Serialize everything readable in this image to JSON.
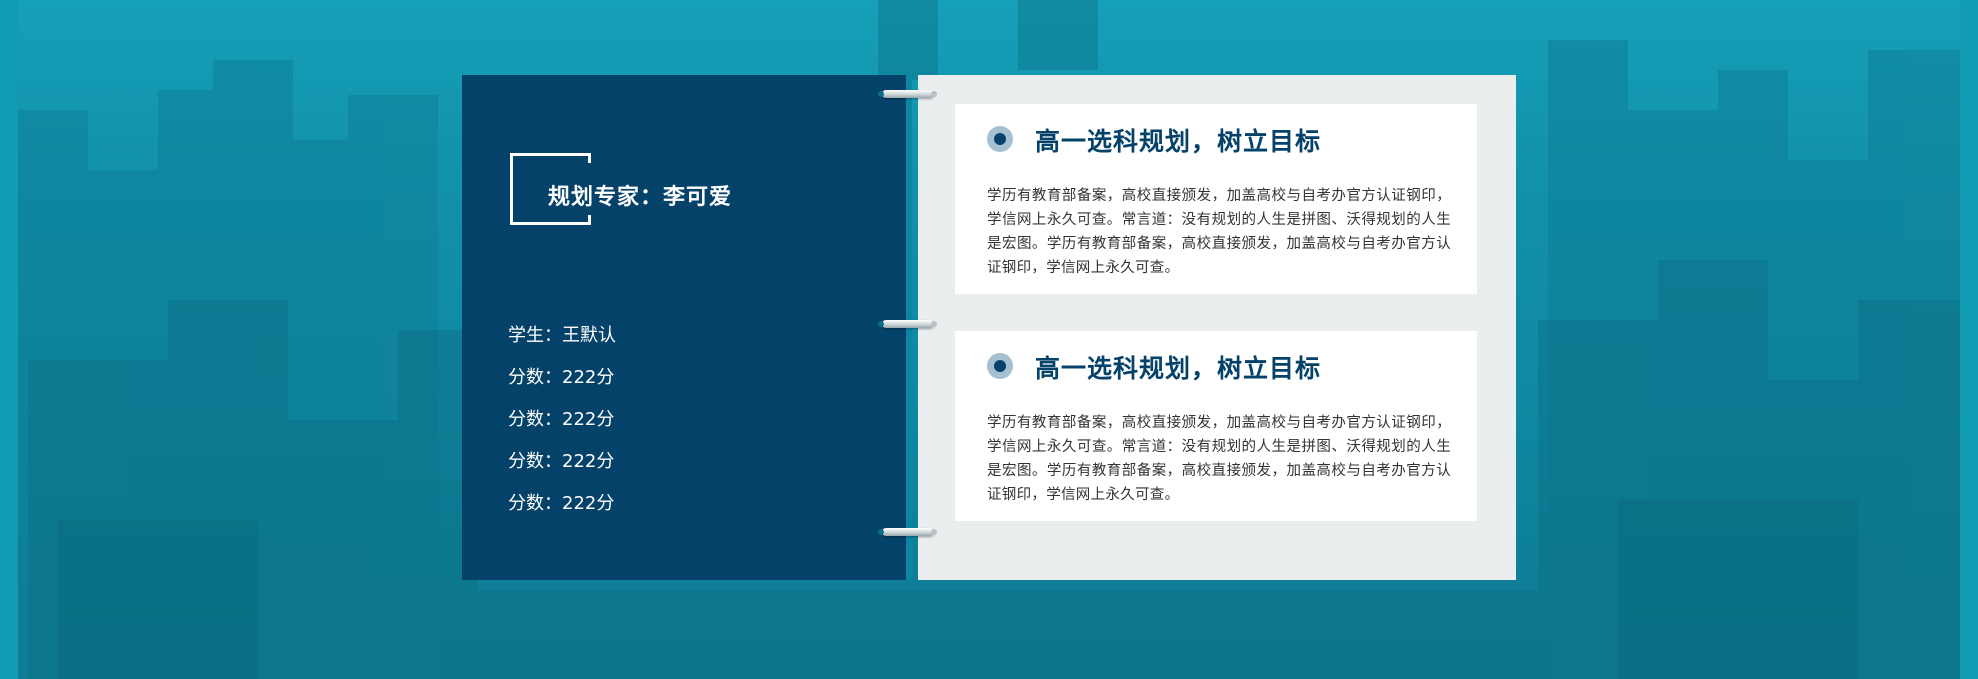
{
  "expert": {
    "title": "规划专家：李可爱"
  },
  "student_info": [
    "学生：王默认",
    "分数：222分",
    "分数：222分",
    "分数：222分",
    "分数：222分"
  ],
  "sections": [
    {
      "title": "高一选科规划，树立目标",
      "body": "学历有教育部备案，高校直接颁发，加盖高校与自考办官方认证钢印，学信网上永久可查。常言道：没有规划的人生是拼图、沃得规划的人生是宏图。学历有教育部备案，高校直接颁发，加盖高校与自考办官方认证钢印，学信网上永久可查。"
    },
    {
      "title": "高一选科规划，树立目标",
      "body": "学历有教育部备案，高校直接颁发，加盖高校与自考办官方认证钢印，学信网上永久可查。常言道：没有规划的人生是拼图、沃得规划的人生是宏图。学历有教育部备案，高校直接颁发，加盖高校与自考办官方认证钢印，学信网上永久可查。"
    }
  ],
  "colors": {
    "background_teal": "#1496ad",
    "navy": "#04426a",
    "panel_light": "#eaeeef",
    "white": "#ffffff"
  },
  "icons": {
    "section_marker": "circle-dot-icon",
    "binder": "binder-ring-icon"
  }
}
